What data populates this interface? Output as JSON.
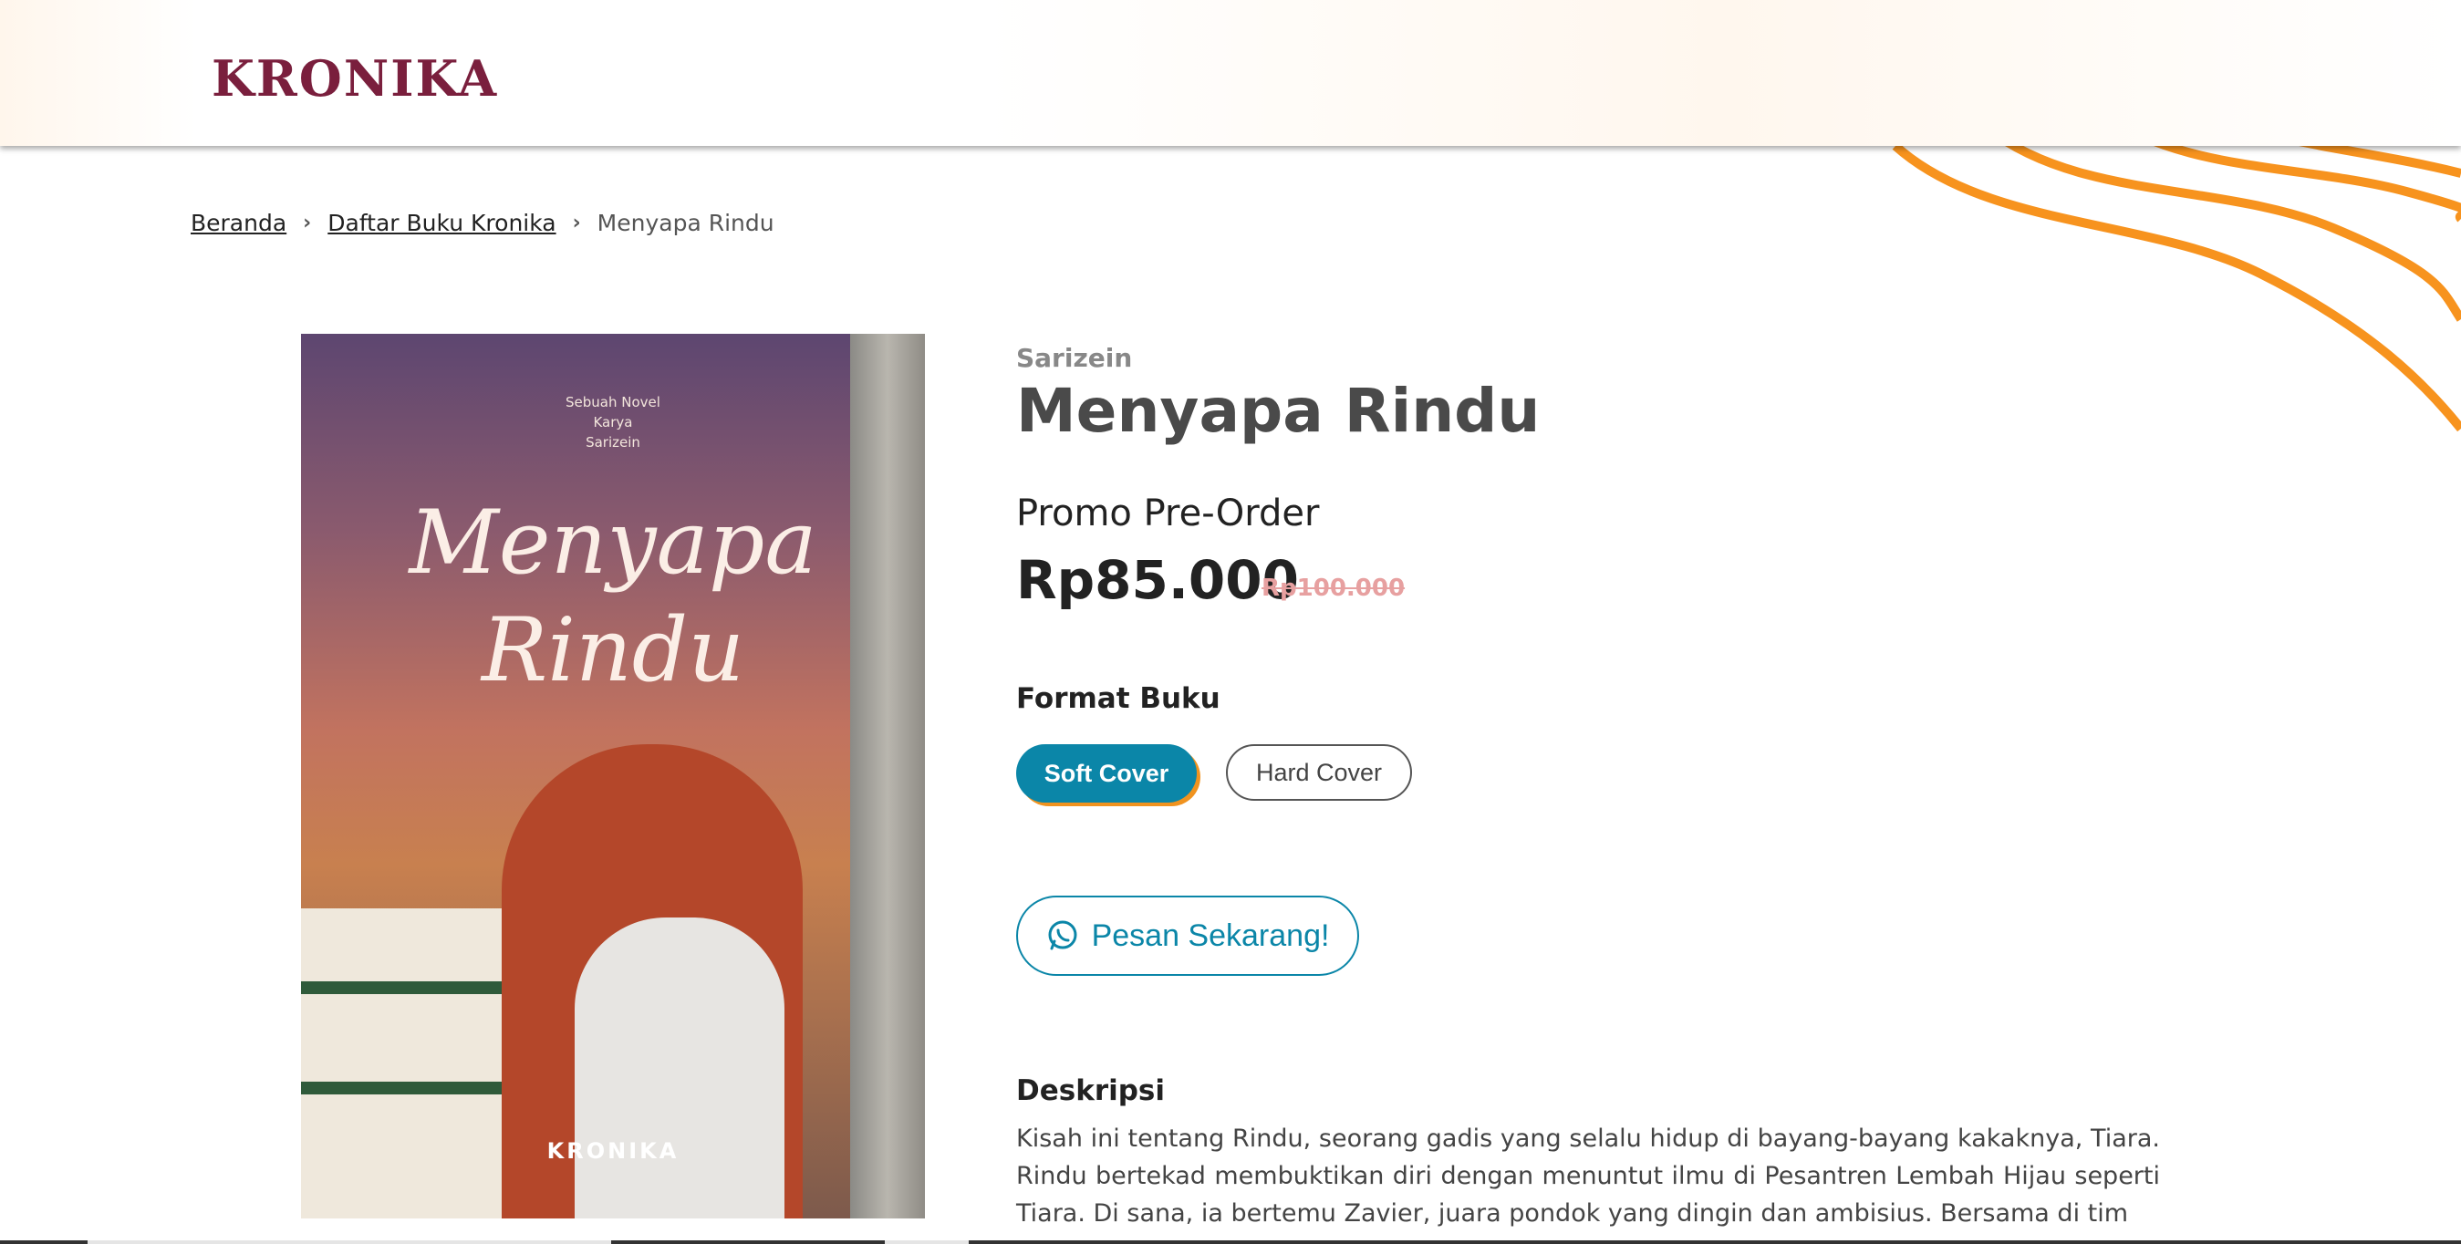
{
  "brand": {
    "logo_text": "KRONIKA"
  },
  "breadcrumb": {
    "home": "Beranda",
    "list": "Daftar Buku Kronika",
    "current": "Menyapa Rindu"
  },
  "cover": {
    "top_line1": "Sebuah Novel",
    "top_line2": "Karya",
    "top_line3": "Sarizein",
    "title_line1": "Menyapa",
    "title_line2": "Rindu",
    "publisher": "KRONIKA"
  },
  "product": {
    "author": "Sarizein",
    "title": "Menyapa Rindu",
    "promo": "Promo Pre-Order",
    "price": "Rp85.000",
    "price_old": "Rp100.000",
    "format_label": "Format Buku",
    "formats": [
      "Soft Cover",
      "Hard Cover"
    ],
    "selected_format": "Soft Cover",
    "order_button": "Pesan Sekarang!",
    "description_label": "Deskripsi",
    "description": "Kisah ini tentang Rindu, seorang gadis yang selalu hidup di bayang-bayang kakaknya, Tiara. Rindu bertekad membuktikan diri dengan menuntut ilmu di Pesantren Lembah Hijau seperti Tiara. Di sana, ia bertemu Zavier, juara pondok yang dingin dan ambisius. Bersama di tim"
  },
  "colors": {
    "brand": "#7a1f3d",
    "accent": "#0b86a8",
    "orange": "#f0931f"
  }
}
